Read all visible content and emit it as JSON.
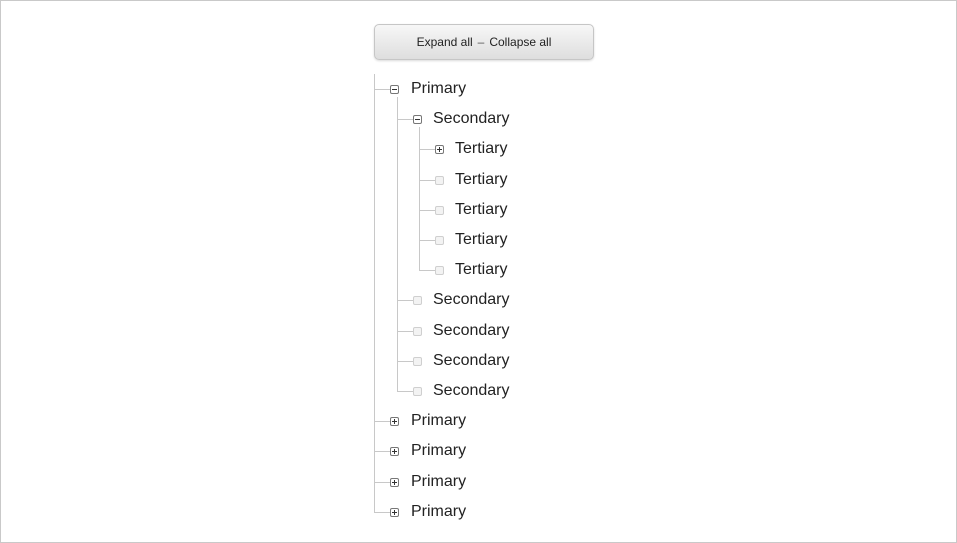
{
  "toolbar": {
    "expand_label": "Expand all",
    "separator": "–",
    "collapse_label": "Collapse all"
  },
  "tree": {
    "nodes": [
      {
        "label": "Primary",
        "level": 1,
        "state": "expanded"
      },
      {
        "label": "Secondary",
        "level": 2,
        "state": "expanded"
      },
      {
        "label": "Tertiary",
        "level": 3,
        "state": "collapsed"
      },
      {
        "label": "Tertiary",
        "level": 3,
        "state": "leaf"
      },
      {
        "label": "Tertiary",
        "level": 3,
        "state": "leaf"
      },
      {
        "label": "Tertiary",
        "level": 3,
        "state": "leaf"
      },
      {
        "label": "Tertiary",
        "level": 3,
        "state": "leaf"
      },
      {
        "label": "Secondary",
        "level": 2,
        "state": "leaf"
      },
      {
        "label": "Secondary",
        "level": 2,
        "state": "leaf"
      },
      {
        "label": "Secondary",
        "level": 2,
        "state": "leaf"
      },
      {
        "label": "Secondary",
        "level": 2,
        "state": "leaf"
      },
      {
        "label": "Primary",
        "level": 1,
        "state": "collapsed"
      },
      {
        "label": "Primary",
        "level": 1,
        "state": "collapsed"
      },
      {
        "label": "Primary",
        "level": 1,
        "state": "collapsed"
      },
      {
        "label": "Primary",
        "level": 1,
        "state": "collapsed"
      }
    ]
  }
}
